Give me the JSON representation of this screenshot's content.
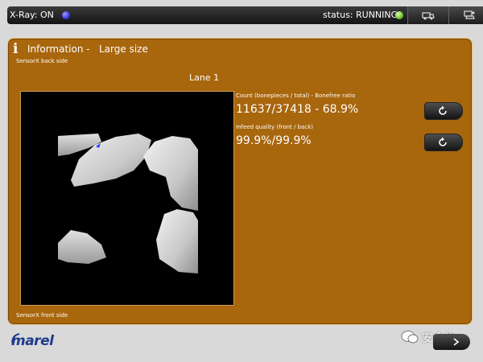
{
  "topbar": {
    "xray_label": "X-Ray: ON",
    "status_label": "status: RUNNING",
    "xray_indicator_color": "#2a2ad8",
    "status_indicator_color": "#5fb81b"
  },
  "panel": {
    "title": "Information -",
    "subtitle": "Large size",
    "sensor_back": "SensorX back side",
    "sensor_front": "SensorX front side",
    "lane": "Lane 1",
    "count_label": "Count (bonepieces / total)  -  Bonefree ratio",
    "count_value": "11637/37418  -  68.9%",
    "infeed_label": "Infeed quality  (front / back)",
    "infeed_value": "99.9%/99.9%",
    "accent_color": "#a8660d"
  },
  "footer": {
    "logo": "marel",
    "watermark": "安全牛"
  }
}
